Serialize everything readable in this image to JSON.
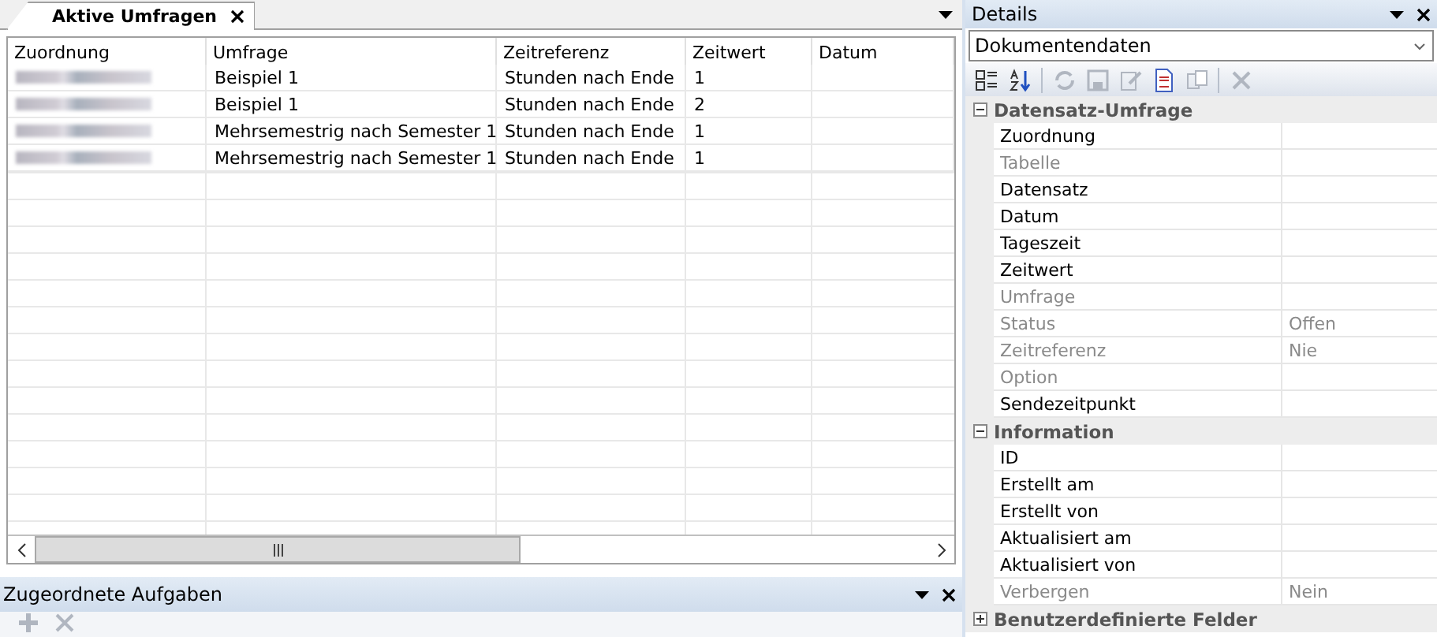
{
  "main_tabs": [
    {
      "label": "Aktive Umfragen",
      "selected": true
    }
  ],
  "table": {
    "columns": [
      "Zuordnung",
      "Umfrage",
      "Zeitreferenz",
      "Zeitwert",
      "Datum"
    ],
    "rows": [
      {
        "zuordnung_redacted": true,
        "cells": [
          "",
          "Beispiel 1",
          "Stunden nach Ende",
          "1",
          ""
        ]
      },
      {
        "zuordnung_redacted": true,
        "cells": [
          "",
          "Beispiel 1",
          "Stunden nach Ende",
          "2",
          ""
        ]
      },
      {
        "zuordnung_redacted": true,
        "cells": [
          "",
          "Mehrsemestrig nach Semester 1",
          "Stunden nach Ende",
          "1",
          ""
        ]
      },
      {
        "zuordnung_redacted": true,
        "cells": [
          "",
          "Mehrsemestrig nach Semester 1",
          "Stunden nach Ende",
          "1",
          ""
        ]
      }
    ]
  },
  "bottom_panel": {
    "title": "Zugeordnete Aufgaben",
    "toolbar": [
      {
        "kind": "add",
        "disabled": true
      },
      {
        "kind": "delete",
        "disabled": true
      }
    ]
  },
  "details": {
    "title": "Details",
    "dropdown": "Dokumentendaten",
    "toolbar": [
      {
        "kind": "categorized",
        "disabled": false
      },
      {
        "kind": "alphabetical",
        "disabled": false
      },
      {
        "kind": "separator"
      },
      {
        "kind": "refresh",
        "disabled": true
      },
      {
        "kind": "save",
        "disabled": true
      },
      {
        "kind": "edit",
        "disabled": true
      },
      {
        "kind": "document",
        "disabled": false
      },
      {
        "kind": "copy",
        "disabled": true
      },
      {
        "kind": "separator"
      },
      {
        "kind": "delete",
        "disabled": true
      }
    ],
    "groups": [
      {
        "title": "Datensatz-Umfrage",
        "expanded": true,
        "properties": [
          {
            "name": "Zuordnung",
            "disabled": false
          },
          {
            "name": "Tabelle",
            "disabled": true
          },
          {
            "name": "Datensatz",
            "disabled": false
          },
          {
            "name": "Datum",
            "disabled": false
          },
          {
            "name": "Tageszeit",
            "disabled": false
          },
          {
            "name": "Zeitwert",
            "disabled": false
          },
          {
            "name": "Umfrage",
            "disabled": true
          },
          {
            "name": "Status",
            "value": "Offen",
            "disabled": true
          },
          {
            "name": "Zeitreferenz",
            "value": "Nie",
            "disabled": true
          },
          {
            "name": "Option",
            "disabled": true
          },
          {
            "name": "Sendezeitpunkt",
            "disabled": false
          }
        ]
      },
      {
        "title": "Information",
        "expanded": true,
        "properties": [
          {
            "name": "ID",
            "disabled": false
          },
          {
            "name": "Erstellt am",
            "disabled": false
          },
          {
            "name": "Erstellt von",
            "disabled": false
          },
          {
            "name": "Aktualisiert am",
            "disabled": false
          },
          {
            "name": "Aktualisiert von",
            "disabled": false
          },
          {
            "name": "Verbergen",
            "value": "Nein",
            "disabled": true
          }
        ]
      },
      {
        "title": "Benutzerdefinierte Felder",
        "expanded": false
      }
    ]
  }
}
